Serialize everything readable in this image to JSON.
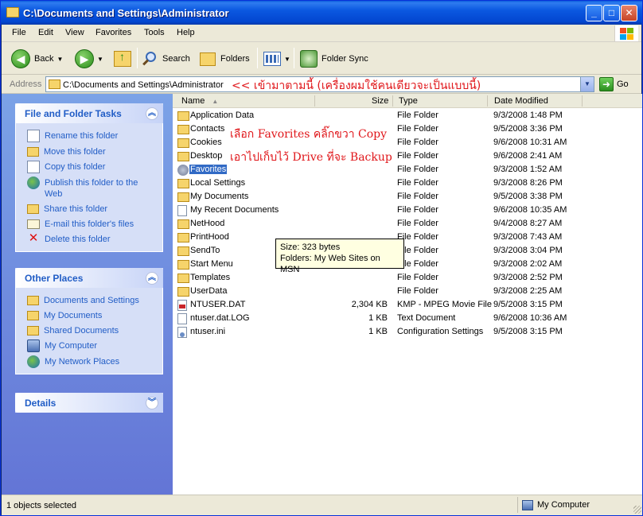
{
  "window": {
    "title": "C:\\Documents and Settings\\Administrator"
  },
  "menu": [
    "File",
    "Edit",
    "View",
    "Favorites",
    "Tools",
    "Help"
  ],
  "toolbar": {
    "back": "Back",
    "search": "Search",
    "folders": "Folders",
    "folder_sync": "Folder Sync"
  },
  "address": {
    "label": "Address",
    "path": "C:\\Documents and Settings\\Administrator",
    "note": "<< เข้ามาตามนี้ (เครื่องผมใช้คนเดียวจะเป็นแบบนี้)",
    "go": "Go"
  },
  "tasks": {
    "title": "File and Folder Tasks",
    "items": [
      {
        "label": "Rename this folder",
        "icon": "rename-icon"
      },
      {
        "label": "Move this folder",
        "icon": "move-folder-icon"
      },
      {
        "label": "Copy this folder",
        "icon": "copy-folder-icon"
      },
      {
        "label": "Publish this folder to the Web",
        "icon": "publish-web-icon"
      },
      {
        "label": "Share this folder",
        "icon": "share-folder-icon"
      },
      {
        "label": "E-mail this folder's files",
        "icon": "email-icon"
      },
      {
        "label": "Delete this folder",
        "icon": "delete-icon"
      }
    ]
  },
  "other_places": {
    "title": "Other Places",
    "items": [
      {
        "label": "Documents and Settings",
        "icon": "folder-icon"
      },
      {
        "label": "My Documents",
        "icon": "folder-icon"
      },
      {
        "label": "Shared Documents",
        "icon": "folder-icon"
      },
      {
        "label": "My Computer",
        "icon": "computer-icon"
      },
      {
        "label": "My Network Places",
        "icon": "network-icon"
      }
    ]
  },
  "details": {
    "title": "Details"
  },
  "columns": {
    "name": "Name",
    "size": "Size",
    "type": "Type",
    "date": "Date Modified"
  },
  "files": [
    {
      "name": "Application Data",
      "size": "",
      "type": "File Folder",
      "date": "9/3/2008 1:48 PM",
      "icon": "folder"
    },
    {
      "name": "Contacts",
      "size": "",
      "type": "File Folder",
      "date": "9/5/2008 3:36 PM",
      "icon": "folder"
    },
    {
      "name": "Cookies",
      "size": "",
      "type": "File Folder",
      "date": "9/6/2008 10:31 AM",
      "icon": "folder"
    },
    {
      "name": "Desktop",
      "size": "",
      "type": "File Folder",
      "date": "9/6/2008 2:41 AM",
      "icon": "folder"
    },
    {
      "name": "Favorites",
      "size": "",
      "type": "File Folder",
      "date": "9/3/2008 1:52 AM",
      "icon": "fav",
      "selected": true
    },
    {
      "name": "Local Settings",
      "size": "",
      "type": "File Folder",
      "date": "9/3/2008 8:26 PM",
      "icon": "folder"
    },
    {
      "name": "My Documents",
      "size": "",
      "type": "File Folder",
      "date": "9/5/2008 3:38 PM",
      "icon": "folder"
    },
    {
      "name": "My Recent Documents",
      "size": "",
      "type": "File Folder",
      "date": "9/6/2008 10:35 AM",
      "icon": "doc"
    },
    {
      "name": "NetHood",
      "size": "",
      "type": "File Folder",
      "date": "9/4/2008 8:27 AM",
      "icon": "folder"
    },
    {
      "name": "PrintHood",
      "size": "",
      "type": "File Folder",
      "date": "9/3/2008 7:43 AM",
      "icon": "folder"
    },
    {
      "name": "SendTo",
      "size": "",
      "type": "File Folder",
      "date": "9/3/2008 3:04 PM",
      "icon": "folder"
    },
    {
      "name": "Start Menu",
      "size": "",
      "type": "File Folder",
      "date": "9/3/2008 2:02 AM",
      "icon": "folder"
    },
    {
      "name": "Templates",
      "size": "",
      "type": "File Folder",
      "date": "9/3/2008 2:52 PM",
      "icon": "folder"
    },
    {
      "name": "UserData",
      "size": "",
      "type": "File Folder",
      "date": "9/3/2008 2:25 AM",
      "icon": "folder"
    },
    {
      "name": "NTUSER.DAT",
      "size": "2,304 KB",
      "type": "KMP - MPEG Movie File",
      "date": "9/5/2008 3:15 PM",
      "icon": "kmp"
    },
    {
      "name": "ntuser.dat.LOG",
      "size": "1 KB",
      "type": "Text Document",
      "date": "9/6/2008 10:36 AM",
      "icon": "doc"
    },
    {
      "name": "ntuser.ini",
      "size": "1 KB",
      "type": "Configuration Settings",
      "date": "9/5/2008 3:15 PM",
      "icon": "ini"
    }
  ],
  "annotations": {
    "line1": "เลือก Favorites คลิ๊กขวา Copy",
    "line2": "เอาไปเก็บไว้ Drive ที่จะ Backup"
  },
  "tooltip": {
    "line1": "Size: 323 bytes",
    "line2": "Folders: My Web Sites on MSN"
  },
  "status": {
    "left": "1 objects selected",
    "right": "My Computer"
  }
}
